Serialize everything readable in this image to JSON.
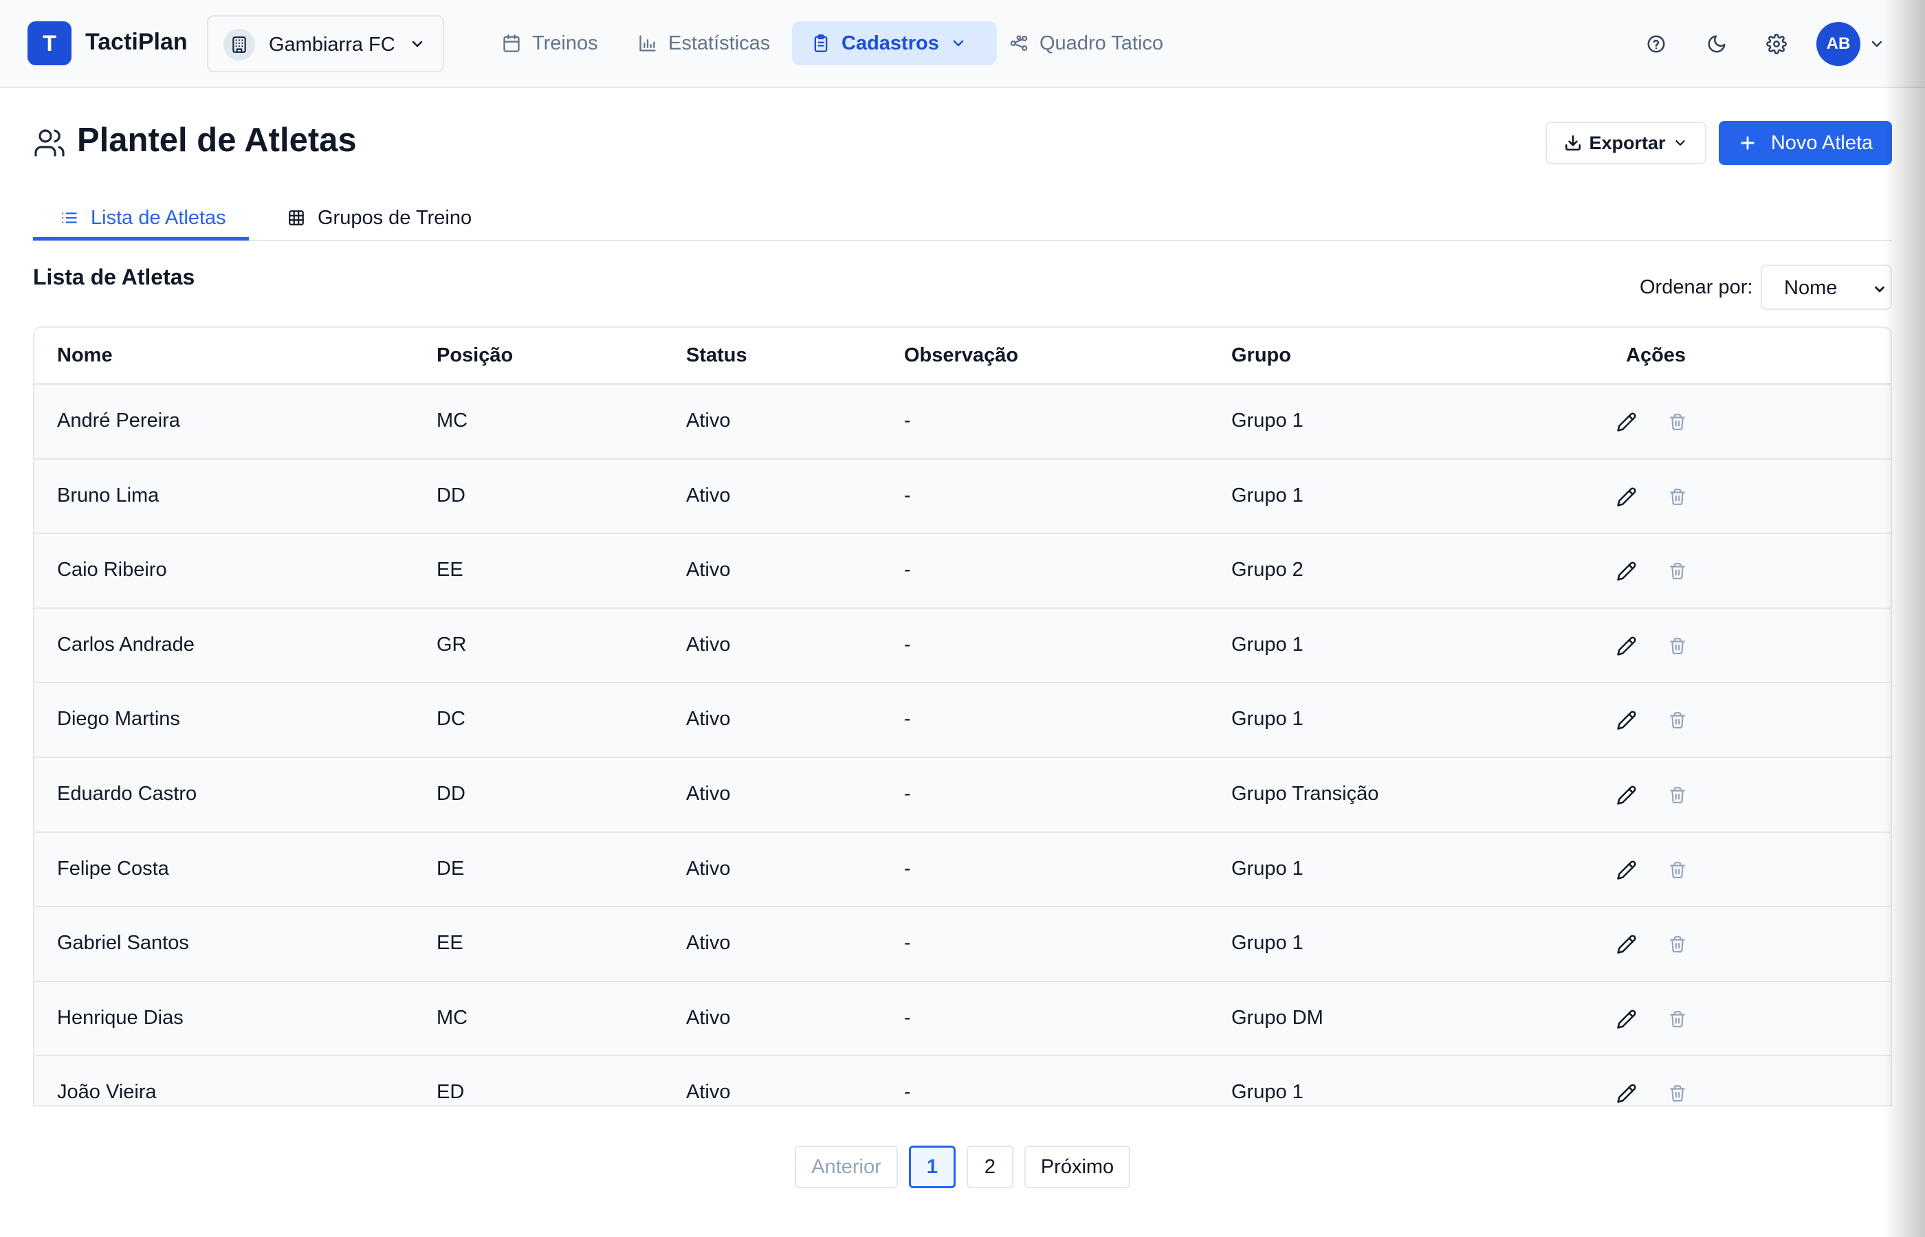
{
  "app": {
    "logo_letter": "T",
    "name": "TactiPlan"
  },
  "team_selector": {
    "value": "Gambiarra FC"
  },
  "nav": [
    {
      "label": "Treinos",
      "icon": "calendar-icon"
    },
    {
      "label": "Estatísticas",
      "icon": "bar-chart-icon"
    },
    {
      "label": "Cadastros",
      "icon": "clipboard-icon",
      "active": true
    },
    {
      "label": "Quadro Tatico",
      "icon": "route-icon"
    }
  ],
  "user": {
    "initials": "AB"
  },
  "page": {
    "title": "Plantel de Atletas",
    "export_label": "Exportar",
    "new_label": "Novo Atleta"
  },
  "tabs": [
    {
      "label": "Lista de Atletas",
      "active": true
    },
    {
      "label": "Grupos de Treino",
      "active": false
    }
  ],
  "list": {
    "title": "Lista de Atletas",
    "sort_label": "Ordenar por:",
    "sort_value": "Nome"
  },
  "table": {
    "columns": [
      "Nome",
      "Posição",
      "Status",
      "Observação",
      "Grupo",
      "Ações"
    ],
    "rows": [
      [
        "André Pereira",
        "MC",
        "Ativo",
        "-",
        "Grupo 1"
      ],
      [
        "Bruno Lima",
        "DD",
        "Ativo",
        "-",
        "Grupo 1"
      ],
      [
        "Caio Ribeiro",
        "EE",
        "Ativo",
        "-",
        "Grupo 2"
      ],
      [
        "Carlos Andrade",
        "GR",
        "Ativo",
        "-",
        "Grupo 1"
      ],
      [
        "Diego Martins",
        "DC",
        "Ativo",
        "-",
        "Grupo 1"
      ],
      [
        "Eduardo Castro",
        "DD",
        "Ativo",
        "-",
        "Grupo Transição"
      ],
      [
        "Felipe Costa",
        "DE",
        "Ativo",
        "-",
        "Grupo 1"
      ],
      [
        "Gabriel Santos",
        "EE",
        "Ativo",
        "-",
        "Grupo 1"
      ],
      [
        "Henrique Dias",
        "MC",
        "Ativo",
        "-",
        "Grupo DM"
      ],
      [
        "João Vieira",
        "ED",
        "Ativo",
        "-",
        "Grupo 1"
      ]
    ]
  },
  "pagination": {
    "prev": "Anterior",
    "pages": [
      "1",
      "2"
    ],
    "current": "1",
    "next": "Próximo"
  },
  "colors": {
    "accent": "#2563eb",
    "brand": "#1d4ed8",
    "delete_icon": "#94a3b8"
  }
}
